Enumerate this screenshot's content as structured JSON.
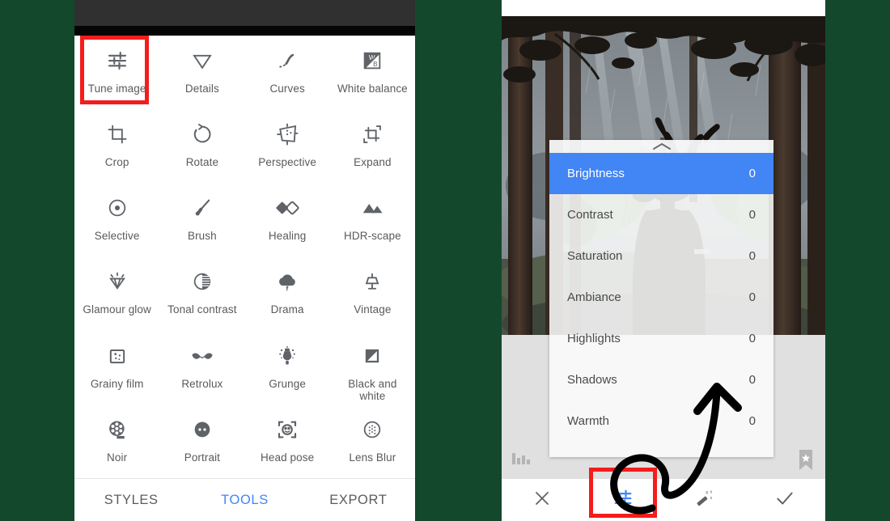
{
  "background_color": "#14482c",
  "accent_color": "#4285f4",
  "highlight_color": "#f41c1c",
  "left_phone": {
    "tools_grid": [
      {
        "label": "Tune image",
        "icon": "tune-sliders-icon",
        "highlighted": true
      },
      {
        "label": "Details",
        "icon": "triangle-down-icon",
        "highlighted": false
      },
      {
        "label": "Curves",
        "icon": "curve-icon",
        "highlighted": false
      },
      {
        "label": "White balance",
        "icon": "white-balance-icon",
        "highlighted": false
      },
      {
        "label": "Crop",
        "icon": "crop-icon",
        "highlighted": false
      },
      {
        "label": "Rotate",
        "icon": "rotate-icon",
        "highlighted": false
      },
      {
        "label": "Perspective",
        "icon": "perspective-icon",
        "highlighted": false
      },
      {
        "label": "Expand",
        "icon": "expand-icon",
        "highlighted": false
      },
      {
        "label": "Selective",
        "icon": "selective-target-icon",
        "highlighted": false
      },
      {
        "label": "Brush",
        "icon": "brush-icon",
        "highlighted": false
      },
      {
        "label": "Healing",
        "icon": "healing-patch-icon",
        "highlighted": false
      },
      {
        "label": "HDR-scape",
        "icon": "mountains-icon",
        "highlighted": false
      },
      {
        "label": "Glamour glow",
        "icon": "glamour-gem-icon",
        "highlighted": false
      },
      {
        "label": "Tonal contrast",
        "icon": "half-circle-contrast-icon",
        "highlighted": false
      },
      {
        "label": "Drama",
        "icon": "storm-cloud-icon",
        "highlighted": false
      },
      {
        "label": "Vintage",
        "icon": "lamp-icon",
        "highlighted": false
      },
      {
        "label": "Grainy film",
        "icon": "grain-square-icon",
        "highlighted": false
      },
      {
        "label": "Retrolux",
        "icon": "moustache-icon",
        "highlighted": false
      },
      {
        "label": "Grunge",
        "icon": "grunge-spray-icon",
        "highlighted": false
      },
      {
        "label": "Black and white",
        "icon": "black-white-square-icon",
        "highlighted": false
      },
      {
        "label": "Noir",
        "icon": "film-reel-icon",
        "highlighted": false
      },
      {
        "label": "Portrait",
        "icon": "face-icon",
        "highlighted": false
      },
      {
        "label": "Head pose",
        "icon": "head-pose-frame-icon",
        "highlighted": false
      },
      {
        "label": "Lens Blur",
        "icon": "lens-blur-dots-icon",
        "highlighted": false
      }
    ],
    "tabs": [
      {
        "label": "STYLES",
        "active": false
      },
      {
        "label": "TOOLS",
        "active": true
      },
      {
        "label": "EXPORT",
        "active": false
      }
    ]
  },
  "right_phone": {
    "adjust_menu": {
      "handle_icon": "chevron-up-icon",
      "rows": [
        {
          "label": "Brightness",
          "value": "0",
          "selected": true
        },
        {
          "label": "Contrast",
          "value": "0",
          "selected": false
        },
        {
          "label": "Saturation",
          "value": "0",
          "selected": false
        },
        {
          "label": "Ambiance",
          "value": "0",
          "selected": false
        },
        {
          "label": "Highlights",
          "value": "0",
          "selected": false
        },
        {
          "label": "Shadows",
          "value": "0",
          "selected": false
        },
        {
          "label": "Warmth",
          "value": "0",
          "selected": false
        }
      ]
    },
    "overlay_icons": [
      {
        "name": "histogram-icon",
        "position": "bottom-left"
      },
      {
        "name": "bookmark-star-icon",
        "position": "bottom-right"
      }
    ],
    "bottom_bar": [
      {
        "name": "close-icon",
        "label": "",
        "highlighted": false
      },
      {
        "name": "tune-sliders-icon",
        "label": "",
        "highlighted": true,
        "active": true
      },
      {
        "name": "magic-wand-icon",
        "label": "",
        "highlighted": false
      },
      {
        "name": "check-icon",
        "label": "",
        "highlighted": false
      }
    ]
  },
  "annotation": {
    "arrow": "hand-drawn-looping-arrow",
    "color": "#000000"
  }
}
